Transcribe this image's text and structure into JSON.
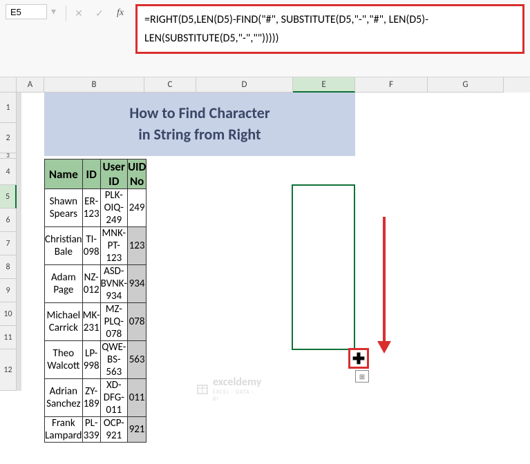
{
  "name_box": "E5",
  "formula": "=RIGHT(D5,LEN(D5)-FIND(\"#\", SUBSTITUTE(D5,\"-\",\"#\", LEN(D5)-LEN(SUBSTITUTE(D5,\"-\",\"\")))))",
  "columns": [
    "A",
    "B",
    "C",
    "D",
    "E",
    "F",
    "G"
  ],
  "visible_rows": [
    "1",
    "2",
    "3",
    "4",
    "5",
    "6",
    "7",
    "8",
    "9",
    "10",
    "11",
    "12"
  ],
  "active_column": "E",
  "active_row": "5",
  "title_line1": "How to Find Character",
  "title_line2": "in String from Right",
  "headers": {
    "name": "Name",
    "id": "ID",
    "userid": "User ID",
    "uid": "UID No"
  },
  "rows": [
    {
      "name": "Shawn Spears",
      "id": "ER-123",
      "userid": "PLK-OIQ-249",
      "uid": "249"
    },
    {
      "name": "Christian Bale",
      "id": "TI-098",
      "userid": "MNK-PT-123",
      "uid": "123"
    },
    {
      "name": "Adam Page",
      "id": "NZ-012",
      "userid": "ASD-BVNK-934",
      "uid": "934"
    },
    {
      "name": "Michael Carrick",
      "id": "MK-231",
      "userid": "MZ-PLQ-078",
      "uid": "078"
    },
    {
      "name": "Theo Walcott",
      "id": "LP-998",
      "userid": "QWE-BS-563",
      "uid": "563"
    },
    {
      "name": "Adrian Sanchez",
      "id": "ZY-189",
      "userid": "XD-DFG-011",
      "uid": "011"
    },
    {
      "name": "Frank Lampard",
      "id": "PL-339",
      "userid": "OCP-921",
      "uid": "921"
    }
  ],
  "watermark": {
    "brand": "exceldemy",
    "tagline": "EXCEL · DATA · BI"
  },
  "icons": {
    "fx": "fx",
    "check": "✓",
    "cross": "✕",
    "dropdown": "▾",
    "fill": "✚",
    "autofill": "⊞"
  }
}
